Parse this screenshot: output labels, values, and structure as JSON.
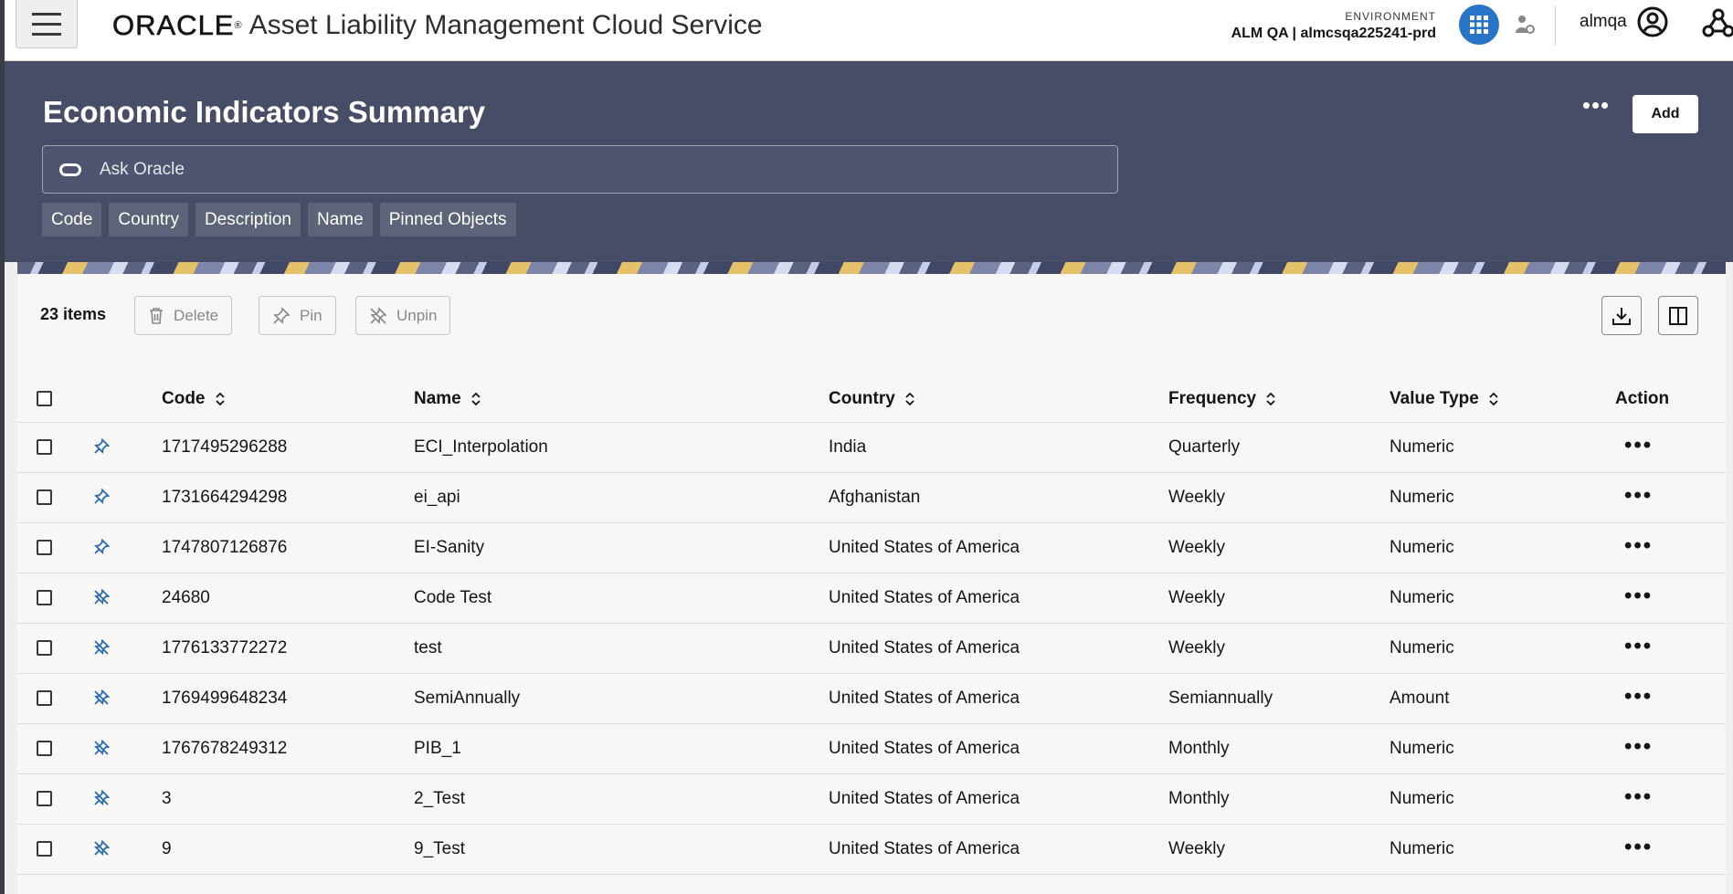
{
  "topbar": {
    "logo": "ORACLE",
    "app_name": "Asset Liability Management Cloud Service",
    "environment_label": "ENVIRONMENT",
    "environment_value": "ALM QA | almcsqa225241-prd",
    "user": "almqa"
  },
  "header": {
    "title": "Economic Indicators Summary",
    "more_label": "•••",
    "add_label": "Add",
    "ask_placeholder": "Ask Oracle",
    "chips": [
      "Code",
      "Country",
      "Description",
      "Name",
      "Pinned Objects"
    ]
  },
  "toolbar": {
    "item_count": "23 items",
    "delete_label": "Delete",
    "pin_label": "Pin",
    "unpin_label": "Unpin"
  },
  "table": {
    "headers": {
      "code": "Code",
      "name": "Name",
      "country": "Country",
      "frequency": "Frequency",
      "value_type": "Value Type",
      "action": "Action"
    },
    "rows": [
      {
        "pinned": true,
        "code": "1717495296288",
        "name": "ECI_Interpolation",
        "country": "India",
        "frequency": "Quarterly",
        "value_type": "Numeric",
        "action": "•••"
      },
      {
        "pinned": true,
        "code": "1731664294298",
        "name": "ei_api",
        "country": "Afghanistan",
        "frequency": "Weekly",
        "value_type": "Numeric",
        "action": "•••"
      },
      {
        "pinned": true,
        "code": "1747807126876",
        "name": "EI-Sanity",
        "country": "United States of America",
        "frequency": "Weekly",
        "value_type": "Numeric",
        "action": "•••"
      },
      {
        "pinned": false,
        "code": "24680",
        "name": "Code Test",
        "country": "United States of America",
        "frequency": "Weekly",
        "value_type": "Numeric",
        "action": "•••"
      },
      {
        "pinned": false,
        "code": "1776133772272",
        "name": "test",
        "country": "United States of America",
        "frequency": "Weekly",
        "value_type": "Numeric",
        "action": "•••"
      },
      {
        "pinned": false,
        "code": "1769499648234",
        "name": "SemiAnnually",
        "country": "United States of America",
        "frequency": "Semiannually",
        "value_type": "Amount",
        "action": "•••"
      },
      {
        "pinned": false,
        "code": "1767678249312",
        "name": "PIB_1",
        "country": "United States of America",
        "frequency": "Monthly",
        "value_type": "Numeric",
        "action": "•••"
      },
      {
        "pinned": false,
        "code": "3",
        "name": "2_Test",
        "country": "United States of America",
        "frequency": "Monthly",
        "value_type": "Numeric",
        "action": "•••"
      },
      {
        "pinned": false,
        "code": "9",
        "name": "9_Test",
        "country": "United States of America",
        "frequency": "Weekly",
        "value_type": "Numeric",
        "action": "•••"
      }
    ]
  },
  "colors": {
    "header_bg": "#474d66",
    "accent_blue": "#2875c8",
    "pin_blue": "#2b6cb0"
  }
}
